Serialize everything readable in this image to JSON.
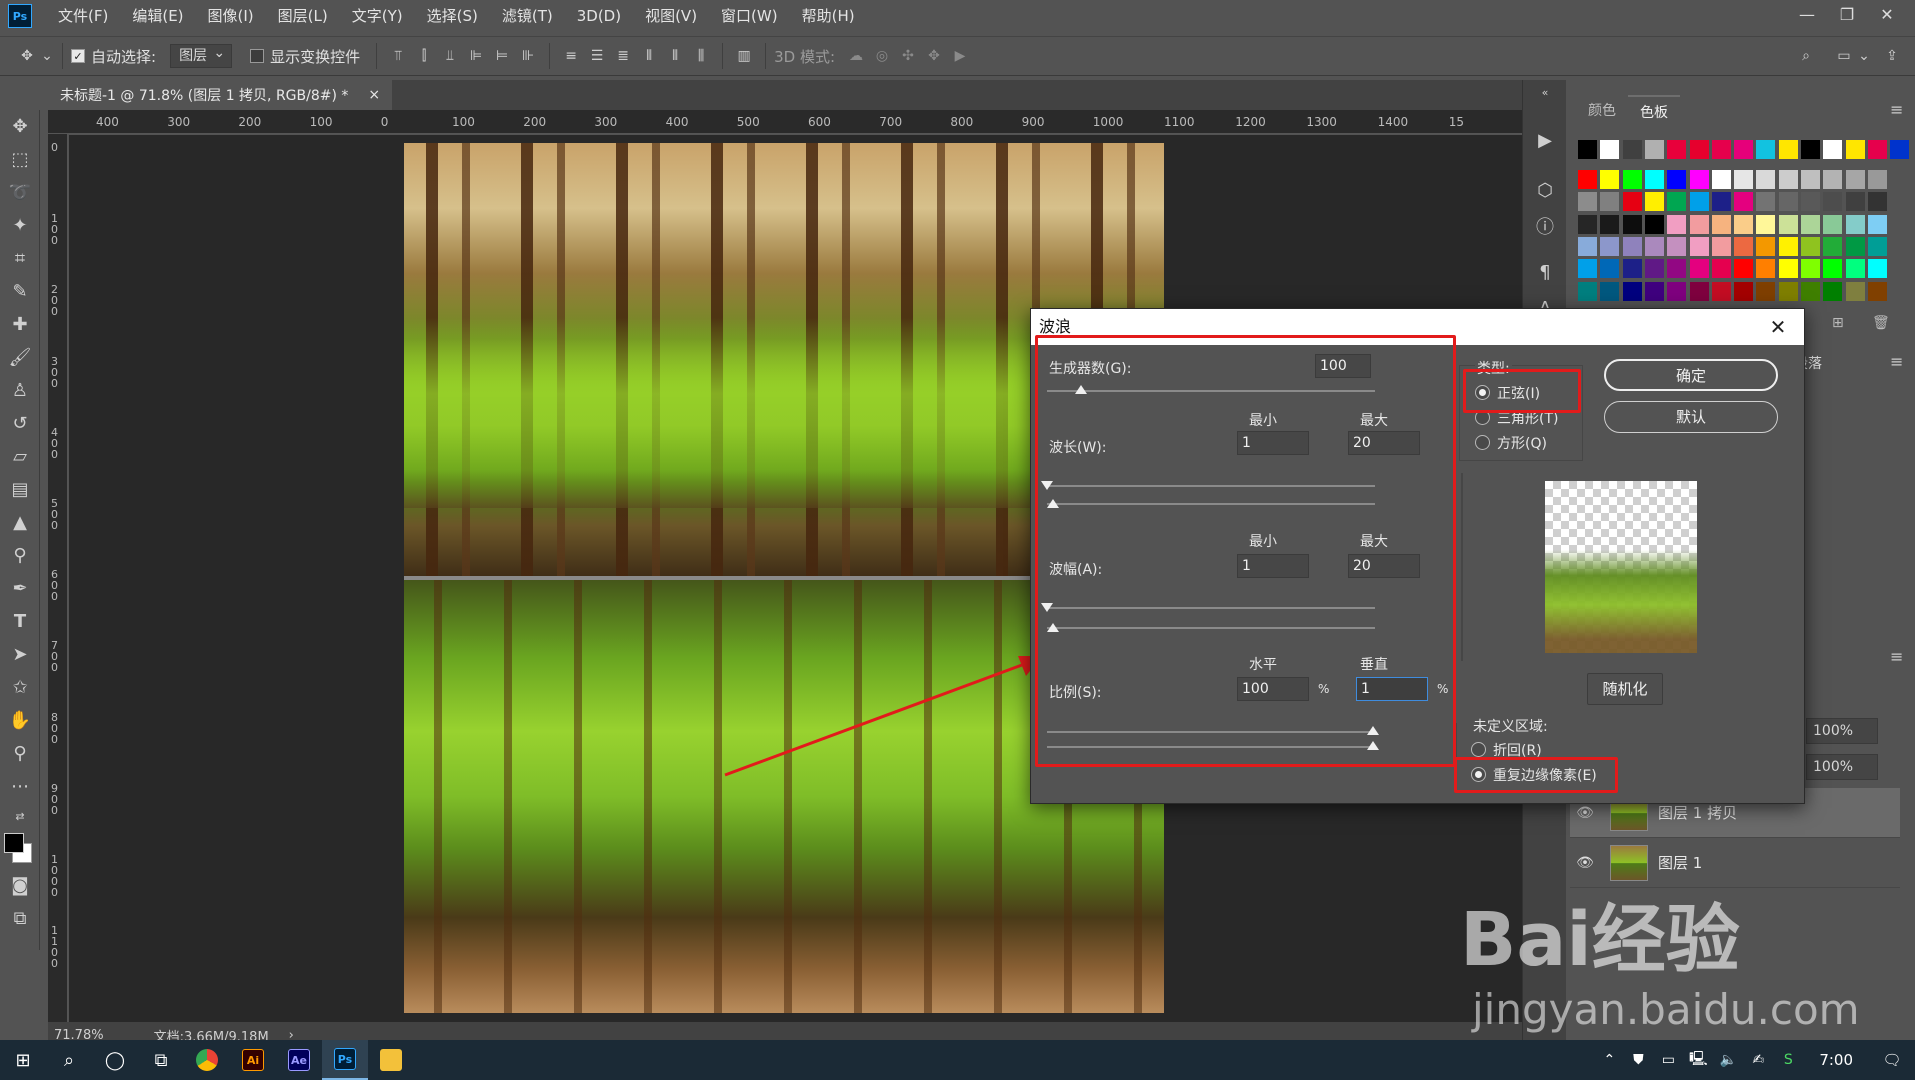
{
  "app": {
    "logo": "Ps"
  },
  "menu": [
    "文件(F)",
    "编辑(E)",
    "图像(I)",
    "图层(L)",
    "文字(Y)",
    "选择(S)",
    "滤镜(T)",
    "3D(D)",
    "视图(V)",
    "窗口(W)",
    "帮助(H)"
  ],
  "options": {
    "auto_select_label": "自动选择:",
    "auto_select_value": "图层",
    "show_transform_label": "显示变换控件",
    "mode_3d_label": "3D 模式:"
  },
  "document_tab": {
    "title": "未标题-1 @ 71.8% (图层 1 拷贝, RGB/8#) *",
    "close": "×"
  },
  "ruler_labels": [
    "400",
    "300",
    "200",
    "100",
    "0",
    "100",
    "200",
    "300",
    "400",
    "500",
    "600",
    "700",
    "800",
    "900",
    "1000",
    "1100",
    "1200",
    "1300",
    "1400",
    "15"
  ],
  "vruler_labels": [
    "0",
    "100",
    "200",
    "300",
    "400",
    "500",
    "600",
    "700",
    "800",
    "900",
    "1000",
    "1100"
  ],
  "status": {
    "zoom": "71.78%",
    "doc": "文档:3.66M/9.18M"
  },
  "panel": {
    "tabs": [
      "颜色",
      "色板"
    ],
    "active_tab": "色板",
    "partial_tab": "段落",
    "pct_fill_1": "100%",
    "pct_fill_2": "100%",
    "layers": [
      {
        "name": "图层 1 拷贝",
        "selected": true
      },
      {
        "name": "图层 1",
        "selected": false
      }
    ]
  },
  "swatch_colors": [
    [
      "#000000",
      "#ffffff",
      "#404040",
      "#b0b0b0",
      "#e8003b",
      "#e6002d",
      "#e6004c",
      "#e6007a",
      "#12c2e0",
      "#ffe600",
      "#000000",
      "#ffffff",
      "#ffe600",
      "#e6004c",
      "#0033cc"
    ],
    [
      "#ff0000",
      "#ffff00",
      "#00ff00",
      "#00ffff",
      "#0000ff",
      "#ff00ff",
      "#ffffff",
      "#e6e6e6",
      "#d9d9d9",
      "#cccccc",
      "#bfbfbf",
      "#b3b3b3",
      "#a6a6a6",
      "#999999"
    ],
    [
      "#8c8c8c",
      "#808080",
      "#e60012",
      "#ffef00",
      "#00a651",
      "#00a0e9",
      "#1d2088",
      "#e4007f",
      "#737373",
      "#666666",
      "#595959",
      "#4d4d4d",
      "#404040",
      "#333333"
    ],
    [
      "#262626",
      "#1a1a1a",
      "#0d0d0d",
      "#000000",
      "#f19ec2",
      "#f29c9f",
      "#f6b37f",
      "#facd89",
      "#fff799",
      "#cce198",
      "#acd598",
      "#89c997",
      "#84ccc9",
      "#7ecef4"
    ],
    [
      "#88abda",
      "#8c97cb",
      "#8f82bc",
      "#aa89bd",
      "#c490bf",
      "#f19ec2",
      "#f29c9f",
      "#ec6941",
      "#f39800",
      "#fff100",
      "#8fc31f",
      "#22ac38",
      "#009944",
      "#009e96"
    ],
    [
      "#00a0e9",
      "#0068b7",
      "#1d2088",
      "#601986",
      "#920783",
      "#e4007f",
      "#e5004f",
      "#ff0000",
      "#ff7f00",
      "#ffff00",
      "#7fff00",
      "#00ff00",
      "#00ff7f",
      "#00ffff"
    ],
    [
      "#007f7f",
      "#00587f",
      "#00007f",
      "#3f007f",
      "#7f007f",
      "#7f003f",
      "#c30d23",
      "#a40000",
      "#7f3f00",
      "#7f7f00",
      "#3f7f00",
      "#007f00",
      "#7f7f3f",
      "#804000"
    ]
  ],
  "dialog": {
    "title": "波浪",
    "close": "✕",
    "generators_label": "生成器数(G):",
    "generators_value": "100",
    "min_label": "最小",
    "max_label": "最大",
    "wavelength_label": "波长(W):",
    "wavelength_min": "1",
    "wavelength_max": "20",
    "amplitude_label": "波幅(A):",
    "amplitude_min": "1",
    "amplitude_max": "20",
    "scale_h_label": "水平",
    "scale_v_label": "垂直",
    "scale_label": "比例(S):",
    "scale_h_value": "100",
    "scale_v_value": "1",
    "percent": "%",
    "type_label": "类型:",
    "types": [
      {
        "label": "正弦(I)",
        "checked": true
      },
      {
        "label": "三角形(T)",
        "checked": false
      },
      {
        "label": "方形(Q)",
        "checked": false
      }
    ],
    "ok": "确定",
    "default": "默认",
    "randomize": "随机化",
    "undefined_label": "未定义区域:",
    "undefined_options": [
      {
        "label": "折回(R)",
        "checked": false
      },
      {
        "label": "重复边缘像素(E)",
        "checked": true
      }
    ]
  },
  "taskbar": {
    "clock": "7:00"
  },
  "watermark": {
    "main": "Bai经验",
    "sub": "jingyan.baidu.com"
  }
}
